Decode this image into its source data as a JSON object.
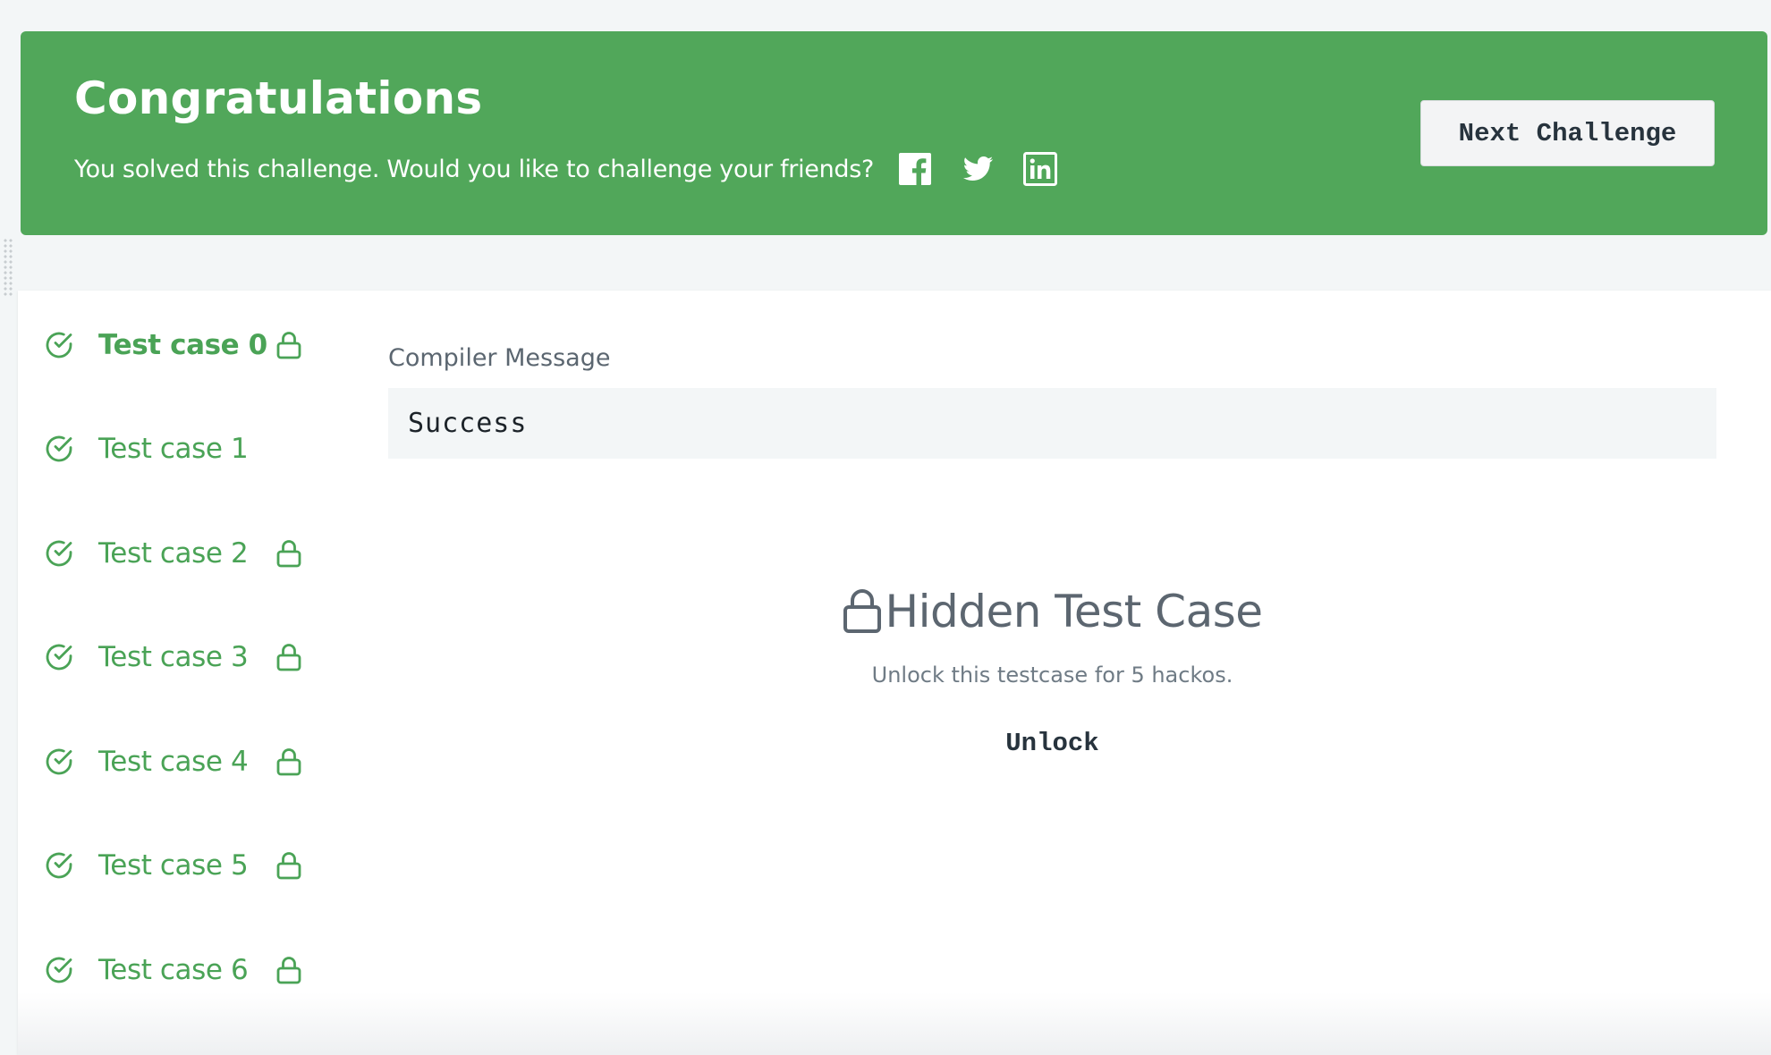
{
  "banner": {
    "title": "Congratulations",
    "subtitle": "You solved this challenge. Would you like to challenge your friends?",
    "share_icons": [
      "facebook-icon",
      "twitter-icon",
      "linkedin-icon"
    ],
    "next_button_label": "Next Challenge",
    "background_color": "#51a75a"
  },
  "test_cases": {
    "items": [
      {
        "label": "Test case 0",
        "passed": true,
        "locked": true,
        "active": true
      },
      {
        "label": "Test case 1",
        "passed": true,
        "locked": false,
        "active": false
      },
      {
        "label": "Test case 2",
        "passed": true,
        "locked": true,
        "active": false
      },
      {
        "label": "Test case 3",
        "passed": true,
        "locked": true,
        "active": false
      },
      {
        "label": "Test case 4",
        "passed": true,
        "locked": true,
        "active": false
      },
      {
        "label": "Test case 5",
        "passed": true,
        "locked": true,
        "active": false
      },
      {
        "label": "Test case 6",
        "passed": true,
        "locked": true,
        "active": false
      }
    ],
    "pass_color": "#4aa356"
  },
  "compiler": {
    "label": "Compiler Message",
    "message": "Success"
  },
  "hidden_case": {
    "title": "Hidden Test Case",
    "description": "Unlock this testcase for 5 hackos.",
    "unlock_label": "Unlock"
  }
}
